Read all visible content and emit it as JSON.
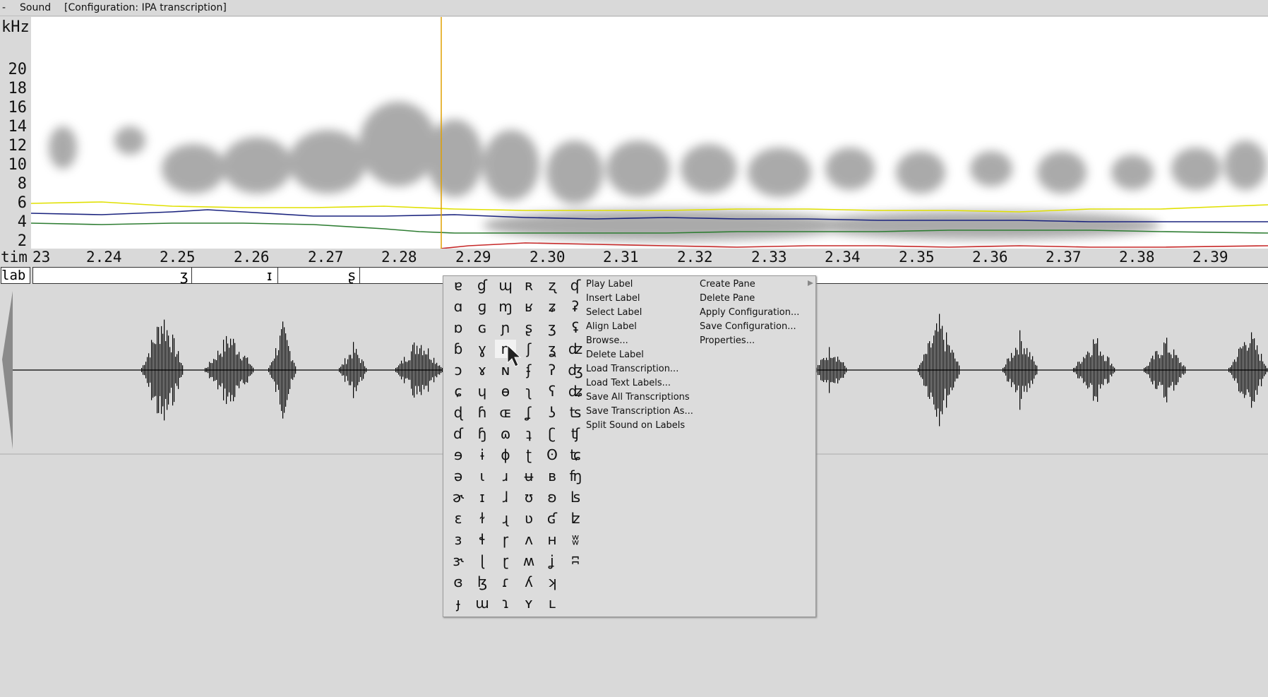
{
  "menubar": {
    "dash": "-",
    "sound": "Sound",
    "config": "[Configuration: IPA transcription]"
  },
  "spectrogram": {
    "y_unit": "kHz",
    "y_ticks": [
      "20",
      "18",
      "16",
      "14",
      "12",
      "10",
      "8",
      "6",
      "4",
      "2"
    ],
    "formant_colors": [
      "#e0e000",
      "#1a237e",
      "#2e7d32",
      "#c62828"
    ],
    "cursor_color": "#e0a000"
  },
  "time_axis": {
    "label": "tim",
    "ticks": [
      "23",
      "2.24",
      "2.25",
      "2.26",
      "2.27",
      "2.28",
      "2.29",
      "2.30",
      "2.31",
      "2.32",
      "2.33",
      "2.34",
      "2.35",
      "2.36",
      "2.37",
      "2.38",
      "2.39"
    ]
  },
  "label_tier": {
    "name": "lab",
    "labels": [
      "ʒ",
      "ɪ",
      "ʂ"
    ]
  },
  "popup": {
    "ipa_columns": [
      [
        "ɐ",
        "ɑ",
        "ɒ",
        "ɓ",
        "ɔ",
        "ɕ",
        "ɖ",
        "ɗ",
        "ɘ",
        "ə",
        "ɚ",
        "ɛ",
        "ɜ",
        "ɝ",
        "ɞ",
        "ɟ"
      ],
      [
        "ɠ",
        "ɡ",
        "ɢ",
        "ɣ",
        "ɤ",
        "ɥ",
        "ɦ",
        "ɧ",
        "ɨ",
        "ɩ",
        "ɪ",
        "ɫ",
        "ɬ",
        "ɭ",
        "ɮ",
        "ɯ"
      ],
      [
        "ɰ",
        "ɱ",
        "ɲ",
        "ɳ",
        "ɴ",
        "ɵ",
        "ɶ",
        "ɷ",
        "ɸ",
        "ɹ",
        "ɺ",
        "ɻ",
        "ɼ",
        "ɽ",
        "ɾ",
        "ɿ"
      ],
      [
        "ʀ",
        "ʁ",
        "ʂ",
        "ʃ",
        "ʄ",
        "ʅ",
        "ʆ",
        "ʇ",
        "ʈ",
        "ʉ",
        "ʊ",
        "ʋ",
        "ʌ",
        "ʍ",
        "ʎ",
        "ʏ"
      ],
      [
        "ʐ",
        "ʑ",
        "ʒ",
        "ʓ",
        "ʔ",
        "ʕ",
        "ʖ",
        "ʗ",
        "ʘ",
        "ʙ",
        "ʚ",
        "ʛ",
        "ʜ",
        "ʝ",
        "ʞ",
        "ʟ"
      ],
      [
        "ʠ",
        "ʡ",
        "ʢ",
        "ʣ",
        "ʤ",
        "ʥ",
        "ʦ",
        "ʧ",
        "ʨ",
        "ʩ",
        "ʪ",
        "ʫ",
        "ʬ",
        "ʭ"
      ]
    ],
    "menu_col1": [
      "Play Label",
      "Insert Label",
      "Select Label",
      "Align Label",
      "Browse...",
      "Delete Label",
      "Load Transcription...",
      "Load Text Labels...",
      "Save All Transcriptions",
      "Save Transcription As...",
      "Split Sound on Labels"
    ],
    "menu_col2": [
      "Create Pane",
      "Delete Pane",
      "Apply Configuration...",
      "Save Configuration...",
      "Properties..."
    ]
  }
}
